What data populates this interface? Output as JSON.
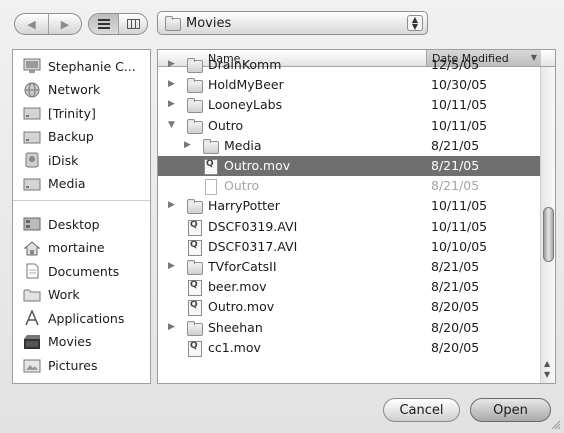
{
  "toolbar": {
    "back_icon": "back-arrow-icon",
    "forward_icon": "forward-arrow-icon",
    "list_view_icon": "list-view-icon",
    "column_view_icon": "column-view-icon",
    "path_label": "Movies"
  },
  "sidebar": {
    "devices": [
      {
        "label": "Stephanie C...",
        "icon": "computer-icon"
      },
      {
        "label": "Network",
        "icon": "network-globe-icon"
      },
      {
        "label": "[Trinity]",
        "icon": "hard-drive-icon"
      },
      {
        "label": "Backup",
        "icon": "hard-drive-icon"
      },
      {
        "label": "iDisk",
        "icon": "idisk-icon"
      },
      {
        "label": "Media",
        "icon": "hard-drive-icon"
      }
    ],
    "places": [
      {
        "label": "Desktop",
        "icon": "desktop-icon"
      },
      {
        "label": "mortaine",
        "icon": "home-icon"
      },
      {
        "label": "Documents",
        "icon": "documents-icon"
      },
      {
        "label": "Work",
        "icon": "folder-icon"
      },
      {
        "label": "Applications",
        "icon": "applications-icon"
      },
      {
        "label": "Movies",
        "icon": "movies-icon"
      },
      {
        "label": "Pictures",
        "icon": "pictures-icon"
      }
    ]
  },
  "filelist": {
    "columns": {
      "name": "Name",
      "date": "Date Modified"
    },
    "rows": [
      {
        "name": "DrainKomm",
        "date": "12/5/05",
        "kind": "folder",
        "level": 0,
        "expander": "right",
        "state": "normal"
      },
      {
        "name": "HoldMyBeer",
        "date": "10/30/05",
        "kind": "folder",
        "level": 0,
        "expander": "right",
        "state": "normal"
      },
      {
        "name": "LooneyLabs",
        "date": "10/11/05",
        "kind": "folder",
        "level": 0,
        "expander": "right",
        "state": "normal"
      },
      {
        "name": "Outro",
        "date": "10/11/05",
        "kind": "folder",
        "level": 0,
        "expander": "down",
        "state": "normal"
      },
      {
        "name": "Media",
        "date": "8/21/05",
        "kind": "folder",
        "level": 1,
        "expander": "right",
        "state": "normal"
      },
      {
        "name": "Outro.mov",
        "date": "8/21/05",
        "kind": "movie",
        "level": 1,
        "expander": "",
        "state": "selected"
      },
      {
        "name": "Outro",
        "date": "8/21/05",
        "kind": "doc",
        "level": 1,
        "expander": "",
        "state": "dim"
      },
      {
        "name": "HarryPotter",
        "date": "10/11/05",
        "kind": "folder",
        "level": 0,
        "expander": "right",
        "state": "normal"
      },
      {
        "name": "DSCF0319.AVI",
        "date": "10/11/05",
        "kind": "movie",
        "level": 0,
        "expander": "",
        "state": "normal"
      },
      {
        "name": "DSCF0317.AVI",
        "date": "10/10/05",
        "kind": "movie",
        "level": 0,
        "expander": "",
        "state": "normal"
      },
      {
        "name": "TVforCatsII",
        "date": "8/21/05",
        "kind": "folder",
        "level": 0,
        "expander": "right",
        "state": "normal"
      },
      {
        "name": "beer.mov",
        "date": "8/21/05",
        "kind": "movie",
        "level": 0,
        "expander": "",
        "state": "normal"
      },
      {
        "name": "Outro.mov",
        "date": "8/20/05",
        "kind": "movie",
        "level": 0,
        "expander": "",
        "state": "normal"
      },
      {
        "name": "Sheehan",
        "date": "8/20/05",
        "kind": "folder",
        "level": 0,
        "expander": "right",
        "state": "normal"
      },
      {
        "name": "cc1.mov",
        "date": "8/20/05",
        "kind": "movie",
        "level": 0,
        "expander": "",
        "state": "normal"
      }
    ]
  },
  "buttons": {
    "cancel": "Cancel",
    "open": "Open"
  }
}
